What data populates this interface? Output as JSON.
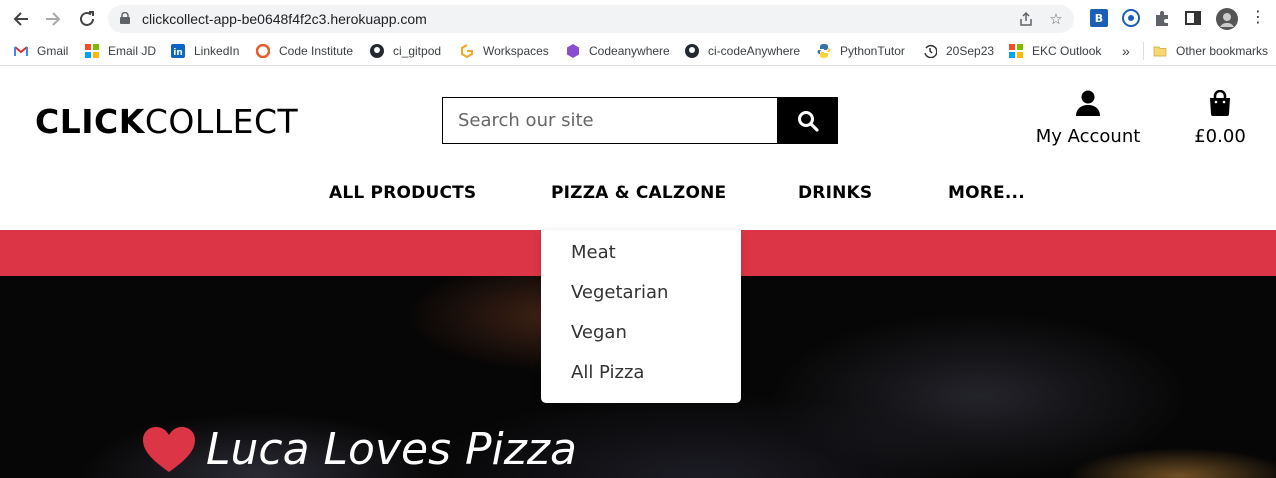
{
  "browser": {
    "url": "clickcollect-app-be0648f4f2c3.herokuapp.com",
    "bookmarks": [
      {
        "label": "Gmail",
        "icon": "gmail-icon"
      },
      {
        "label": "Email JD",
        "icon": "microsoft-icon"
      },
      {
        "label": "LinkedIn",
        "icon": "linkedin-icon"
      },
      {
        "label": "Code Institute",
        "icon": "code-institute-icon"
      },
      {
        "label": "ci_gitpod",
        "icon": "github-icon"
      },
      {
        "label": "Workspaces",
        "icon": "gitpod-icon"
      },
      {
        "label": "Codeanywhere",
        "icon": "codeanywhere-icon"
      },
      {
        "label": "ci-codeAnywhere",
        "icon": "github-icon"
      },
      {
        "label": "PythonTutor",
        "icon": "python-icon"
      },
      {
        "label": "20Sep23",
        "icon": "history-icon"
      },
      {
        "label": "EKC Outlook",
        "icon": "microsoft-icon"
      }
    ],
    "more_bookmarks": "»",
    "other_bookmarks": "Other bookmarks"
  },
  "header": {
    "logo_bold": "CLICK",
    "logo_light": "COLLECT",
    "search_placeholder": "Search our site",
    "account_label": "My Account",
    "bag_total": "£0.00"
  },
  "nav": {
    "items": [
      "ALL PRODUCTS",
      "PIZZA & CALZONE",
      "DRINKS",
      "MORE..."
    ]
  },
  "dropdown": {
    "items": [
      "Meat",
      "Vegetarian",
      "Vegan",
      "All Pizza"
    ]
  },
  "hero": {
    "title": "Luca Loves Pizza"
  },
  "colors": {
    "banner": "#dc3545",
    "heart": "#dc3545",
    "brand": "#000000"
  }
}
